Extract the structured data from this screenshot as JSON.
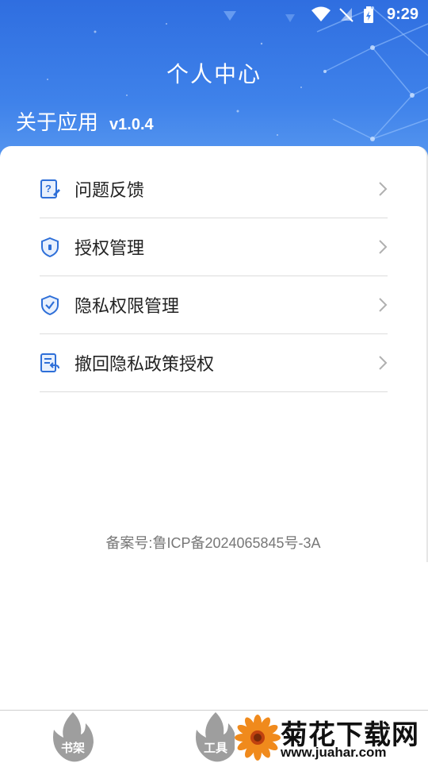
{
  "status_bar": {
    "time": "9:29"
  },
  "header": {
    "title": "个人中心",
    "about_label": "关于应用",
    "version": "v1.0.4"
  },
  "menu": {
    "items": [
      {
        "label": "问题反馈",
        "icon": "feedback-icon"
      },
      {
        "label": "授权管理",
        "icon": "shield-lock-icon"
      },
      {
        "label": "隐私权限管理",
        "icon": "shield-check-icon"
      },
      {
        "label": "撤回隐私政策授权",
        "icon": "revoke-document-icon"
      }
    ]
  },
  "beian": "备案号:鲁ICP备2024065845号-3A",
  "bottom_nav": {
    "items": [
      {
        "label": "书架",
        "icon": "flame-icon"
      },
      {
        "label": "工具",
        "icon": "flame-icon"
      }
    ]
  },
  "watermark": {
    "name": "菊花下载网",
    "url": "www.juahar.com"
  },
  "colors": {
    "header_blue": "#3f82ea",
    "icon_blue": "#2e6fd8",
    "text": "#222222",
    "muted": "#777777"
  }
}
